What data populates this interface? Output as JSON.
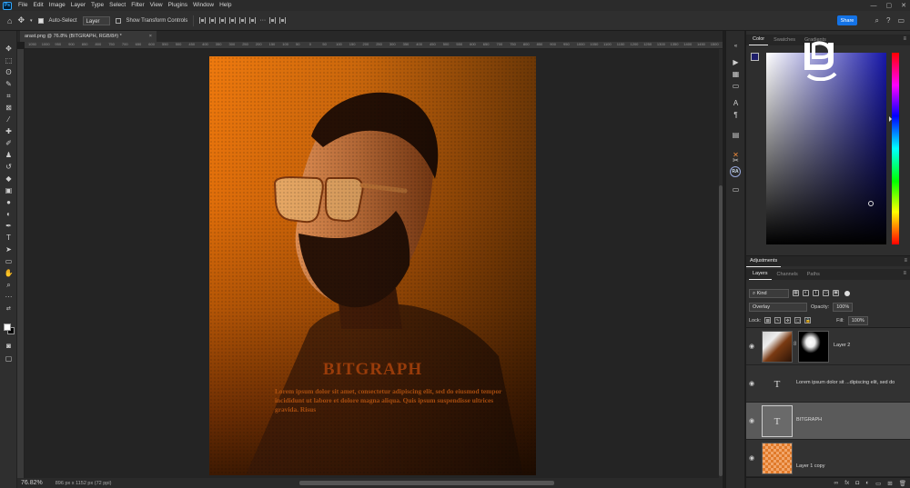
{
  "menubar": {
    "app_badge": "Ps",
    "items": [
      "File",
      "Edit",
      "Image",
      "Layer",
      "Type",
      "Select",
      "Filter",
      "View",
      "Plugins",
      "Window",
      "Help"
    ],
    "window_controls": [
      "—",
      "▢",
      "✕"
    ]
  },
  "optionsbar": {
    "auto_select_label": "Auto-Select",
    "auto_select_target": "Layer",
    "transform_controls_label": "Show Transform Controls",
    "share_label": "Share"
  },
  "document": {
    "tab_title": "arast.png @ 76.8% (BITGRAPH, RGB/8#) *",
    "close_glyph": "×",
    "ruler_ticks": [
      "1050",
      "1000",
      "950",
      "900",
      "850",
      "800",
      "750",
      "700",
      "650",
      "600",
      "550",
      "500",
      "450",
      "400",
      "350",
      "300",
      "250",
      "200",
      "150",
      "100",
      "50",
      "0",
      "50",
      "100",
      "150",
      "200",
      "250",
      "300",
      "350",
      "400",
      "450",
      "500",
      "550",
      "600",
      "650",
      "700",
      "750",
      "800",
      "850",
      "900",
      "950",
      "1000",
      "1050",
      "1100",
      "1150",
      "1200",
      "1250",
      "1300",
      "1350",
      "1400",
      "1450",
      "1500"
    ],
    "zoom": "76.82%",
    "info": "896 px x 1152 px (72 ppi)"
  },
  "poster": {
    "title": "BITGRAPH",
    "body": "Lorem ipsum dolor sit amet, consectetur adipiscing elit, sed do eiusmod tempor incididunt ut labore et dolore magna aliqua. Quis ipsum suspendisse ultrices gravida. Risus"
  },
  "color_panel": {
    "tabs": [
      "Color",
      "Swatches",
      "Gradients"
    ],
    "foreground": "#1e1e6a"
  },
  "adjustments": {
    "title": "Adjustments"
  },
  "layers_panel": {
    "tabs": [
      "Layers",
      "Channels",
      "Paths"
    ],
    "kind_label": "Kind",
    "blend_mode": "Overlay",
    "opacity_label": "Opacity:",
    "opacity_value": "100%",
    "lock_label": "Lock:",
    "fill_label": "Fill:",
    "fill_value": "100%",
    "layers": [
      {
        "name": "Layer 2",
        "type": "pixel-with-mask",
        "selected": false
      },
      {
        "name": "Lorem ipsum dolor sit ...dipiscing elit, sed do",
        "type": "text",
        "selected": false
      },
      {
        "name": "BITGRAPH",
        "type": "text",
        "selected": true
      },
      {
        "name": "Layer 1 copy",
        "type": "pixel",
        "selected": false
      }
    ],
    "bottom_icons": [
      "link-icon",
      "fx-icon",
      "mask-icon",
      "adjustment-icon",
      "folder-icon",
      "new-layer-icon",
      "trash-icon"
    ]
  },
  "colors": {
    "accent": "#1473e6",
    "poster_orange": "#ef7a0e",
    "panel_bg": "#2e2e2e"
  }
}
